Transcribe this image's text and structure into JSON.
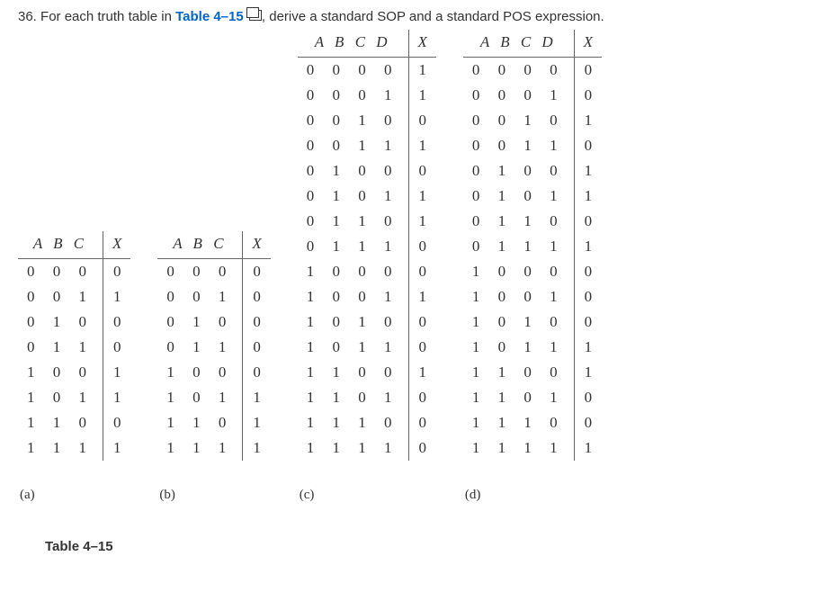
{
  "question": {
    "number": "36.",
    "text_before_ref": " For each truth table in ",
    "table_ref": "Table 4–15",
    "text_after_ref": ", derive a standard SOP and a standard POS expression."
  },
  "headers3": {
    "vars": "A B C",
    "out": "X"
  },
  "headers4": {
    "vars": "A B C D",
    "out": "X"
  },
  "table_a": {
    "label": "(a)",
    "rows": [
      {
        "v": "0 0 0",
        "x": "0"
      },
      {
        "v": "0 0 1",
        "x": "1"
      },
      {
        "v": "0 1 0",
        "x": "0"
      },
      {
        "v": "0 1 1",
        "x": "0"
      },
      {
        "v": "1 0 0",
        "x": "1"
      },
      {
        "v": "1 0 1",
        "x": "1"
      },
      {
        "v": "1 1 0",
        "x": "0"
      },
      {
        "v": "1 1 1",
        "x": "1"
      }
    ]
  },
  "table_b": {
    "label": "(b)",
    "rows": [
      {
        "v": "0 0 0",
        "x": "0"
      },
      {
        "v": "0 0 1",
        "x": "0"
      },
      {
        "v": "0 1 0",
        "x": "0"
      },
      {
        "v": "0 1 1",
        "x": "0"
      },
      {
        "v": "1 0 0",
        "x": "0"
      },
      {
        "v": "1 0 1",
        "x": "1"
      },
      {
        "v": "1 1 0",
        "x": "1"
      },
      {
        "v": "1 1 1",
        "x": "1"
      }
    ]
  },
  "table_c": {
    "label": "(c)",
    "rows": [
      {
        "v": "0 0 0 0",
        "x": "1"
      },
      {
        "v": "0 0 0 1",
        "x": "1"
      },
      {
        "v": "0 0 1 0",
        "x": "0"
      },
      {
        "v": "0 0 1 1",
        "x": "1"
      },
      {
        "v": "0 1 0 0",
        "x": "0"
      },
      {
        "v": "0 1 0 1",
        "x": "1"
      },
      {
        "v": "0 1 1 0",
        "x": "1"
      },
      {
        "v": "0 1 1 1",
        "x": "0"
      },
      {
        "v": "1 0 0 0",
        "x": "0"
      },
      {
        "v": "1 0 0 1",
        "x": "1"
      },
      {
        "v": "1 0 1 0",
        "x": "0"
      },
      {
        "v": "1 0 1 1",
        "x": "0"
      },
      {
        "v": "1 1 0 0",
        "x": "1"
      },
      {
        "v": "1 1 0 1",
        "x": "0"
      },
      {
        "v": "1 1 1 0",
        "x": "0"
      },
      {
        "v": "1 1 1 1",
        "x": "0"
      }
    ]
  },
  "table_d": {
    "label": "(d)",
    "rows": [
      {
        "v": "0 0 0 0",
        "x": "0"
      },
      {
        "v": "0 0 0 1",
        "x": "0"
      },
      {
        "v": "0 0 1 0",
        "x": "1"
      },
      {
        "v": "0 0 1 1",
        "x": "0"
      },
      {
        "v": "0 1 0 0",
        "x": "1"
      },
      {
        "v": "0 1 0 1",
        "x": "1"
      },
      {
        "v": "0 1 1 0",
        "x": "0"
      },
      {
        "v": "0 1 1 1",
        "x": "1"
      },
      {
        "v": "1 0 0 0",
        "x": "0"
      },
      {
        "v": "1 0 0 1",
        "x": "0"
      },
      {
        "v": "1 0 1 0",
        "x": "0"
      },
      {
        "v": "1 0 1 1",
        "x": "1"
      },
      {
        "v": "1 1 0 0",
        "x": "1"
      },
      {
        "v": "1 1 0 1",
        "x": "0"
      },
      {
        "v": "1 1 1 0",
        "x": "0"
      },
      {
        "v": "1 1 1 1",
        "x": "1"
      }
    ]
  },
  "caption": "Table 4–15"
}
